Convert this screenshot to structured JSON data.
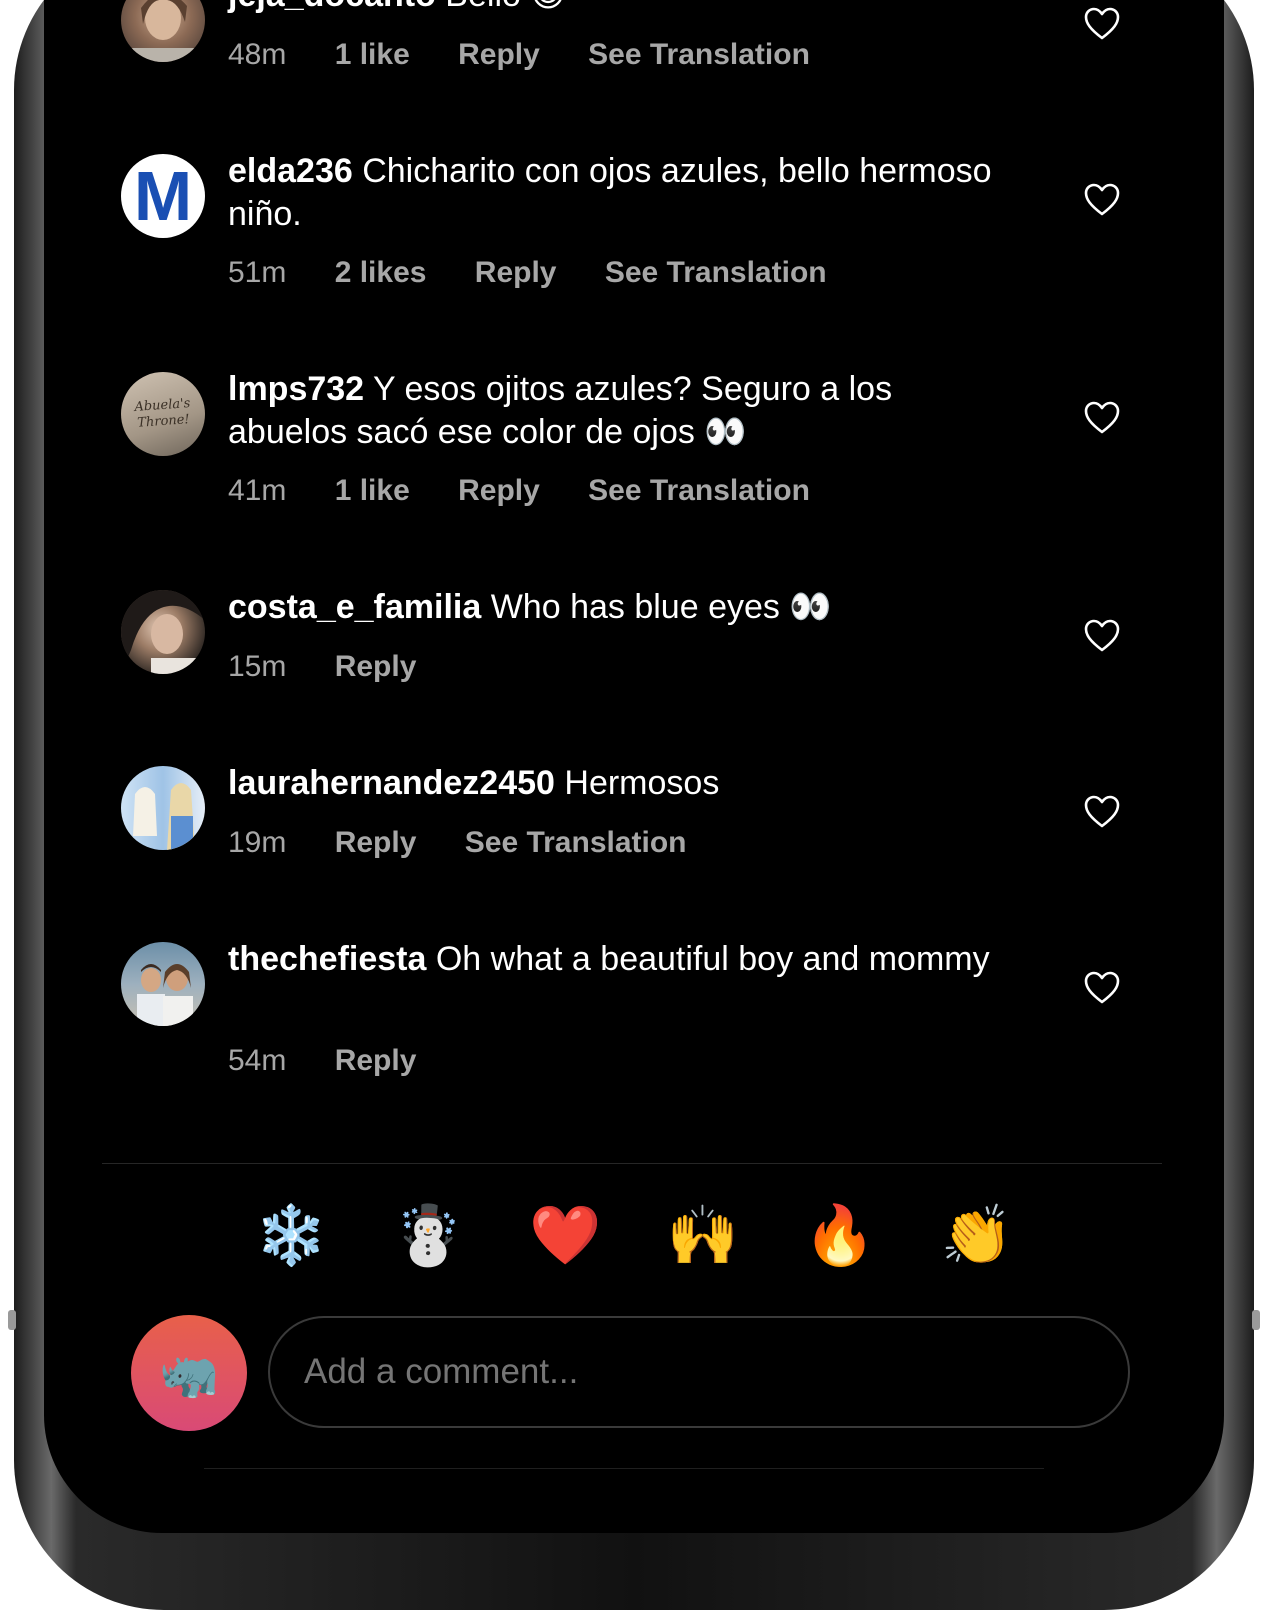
{
  "comments": [
    {
      "username": "jeja_docanto",
      "text": "Bello",
      "emoji": "😍",
      "time": "48m",
      "likes": "1 like",
      "reply": "Reply",
      "translate": "See Translation"
    },
    {
      "username": "elda236",
      "text": "Chicharito con ojos azules, bello hermoso niño.",
      "emoji": "",
      "time": "51m",
      "likes": "2 likes",
      "reply": "Reply",
      "translate": "See Translation"
    },
    {
      "username": "lmps732",
      "text": "Y esos ojitos azules? Seguro a  los abuelos sacó ese color de ojos",
      "emoji": "👀",
      "time": "41m",
      "likes": "1 like",
      "reply": "Reply",
      "translate": "See Translation"
    },
    {
      "username": "costa_e_familia",
      "text": "Who has blue eyes",
      "emoji": "👀",
      "time": "15m",
      "likes": "",
      "reply": "Reply",
      "translate": ""
    },
    {
      "username": "laurahernandez2450",
      "text": "Hermosos",
      "emoji": "",
      "time": "19m",
      "likes": "",
      "reply": "Reply",
      "translate": "See Translation"
    },
    {
      "username": "thechefiesta",
      "text": "Oh what a beautiful boy and mommy",
      "emoji": "",
      "time": "54m",
      "likes": "",
      "reply": "Reply",
      "translate": ""
    }
  ],
  "avatars": {
    "elda236_letter": "M",
    "lmps732_sign": "Abuela's Throne!"
  },
  "quick_reactions": [
    "😳",
    "❄️",
    "☃️",
    "❤️",
    "🙌",
    "🔥",
    "👏",
    "😢"
  ],
  "composer": {
    "placeholder": "Add a comment...",
    "avatar_emoji": "🦏"
  },
  "colors": {
    "background": "#000000",
    "text": "#ffffff",
    "meta": "#a7a7a7",
    "heart_outline": "#ffffff",
    "m_logo": "#1a4fb3"
  }
}
